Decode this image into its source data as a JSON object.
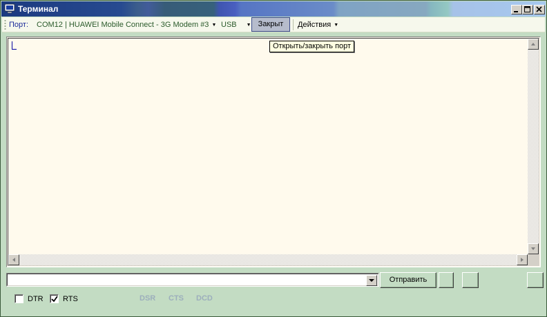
{
  "window": {
    "title": "Терминал"
  },
  "toolbar": {
    "port_label": "Порт:",
    "port_value": "COM12 | HUAWEI Mobile Connect - 3G Modem #3",
    "usb_value": "USB",
    "close_button": "Закрыт",
    "actions_menu": "Действия"
  },
  "tooltip": {
    "text": "Открыть/закрыть порт"
  },
  "send": {
    "input_value": "",
    "send_button": "Отправить"
  },
  "signals": {
    "dtr_label": "DTR",
    "dtr_checked": false,
    "rts_label": "RTS",
    "rts_checked": true,
    "dsr": "DSR",
    "cts": "CTS",
    "dcd": "DCD"
  },
  "colors": {
    "window_bg": "#c3dcc3",
    "terminal_bg": "#fffaed",
    "indicator_inactive": "#9caebc"
  }
}
